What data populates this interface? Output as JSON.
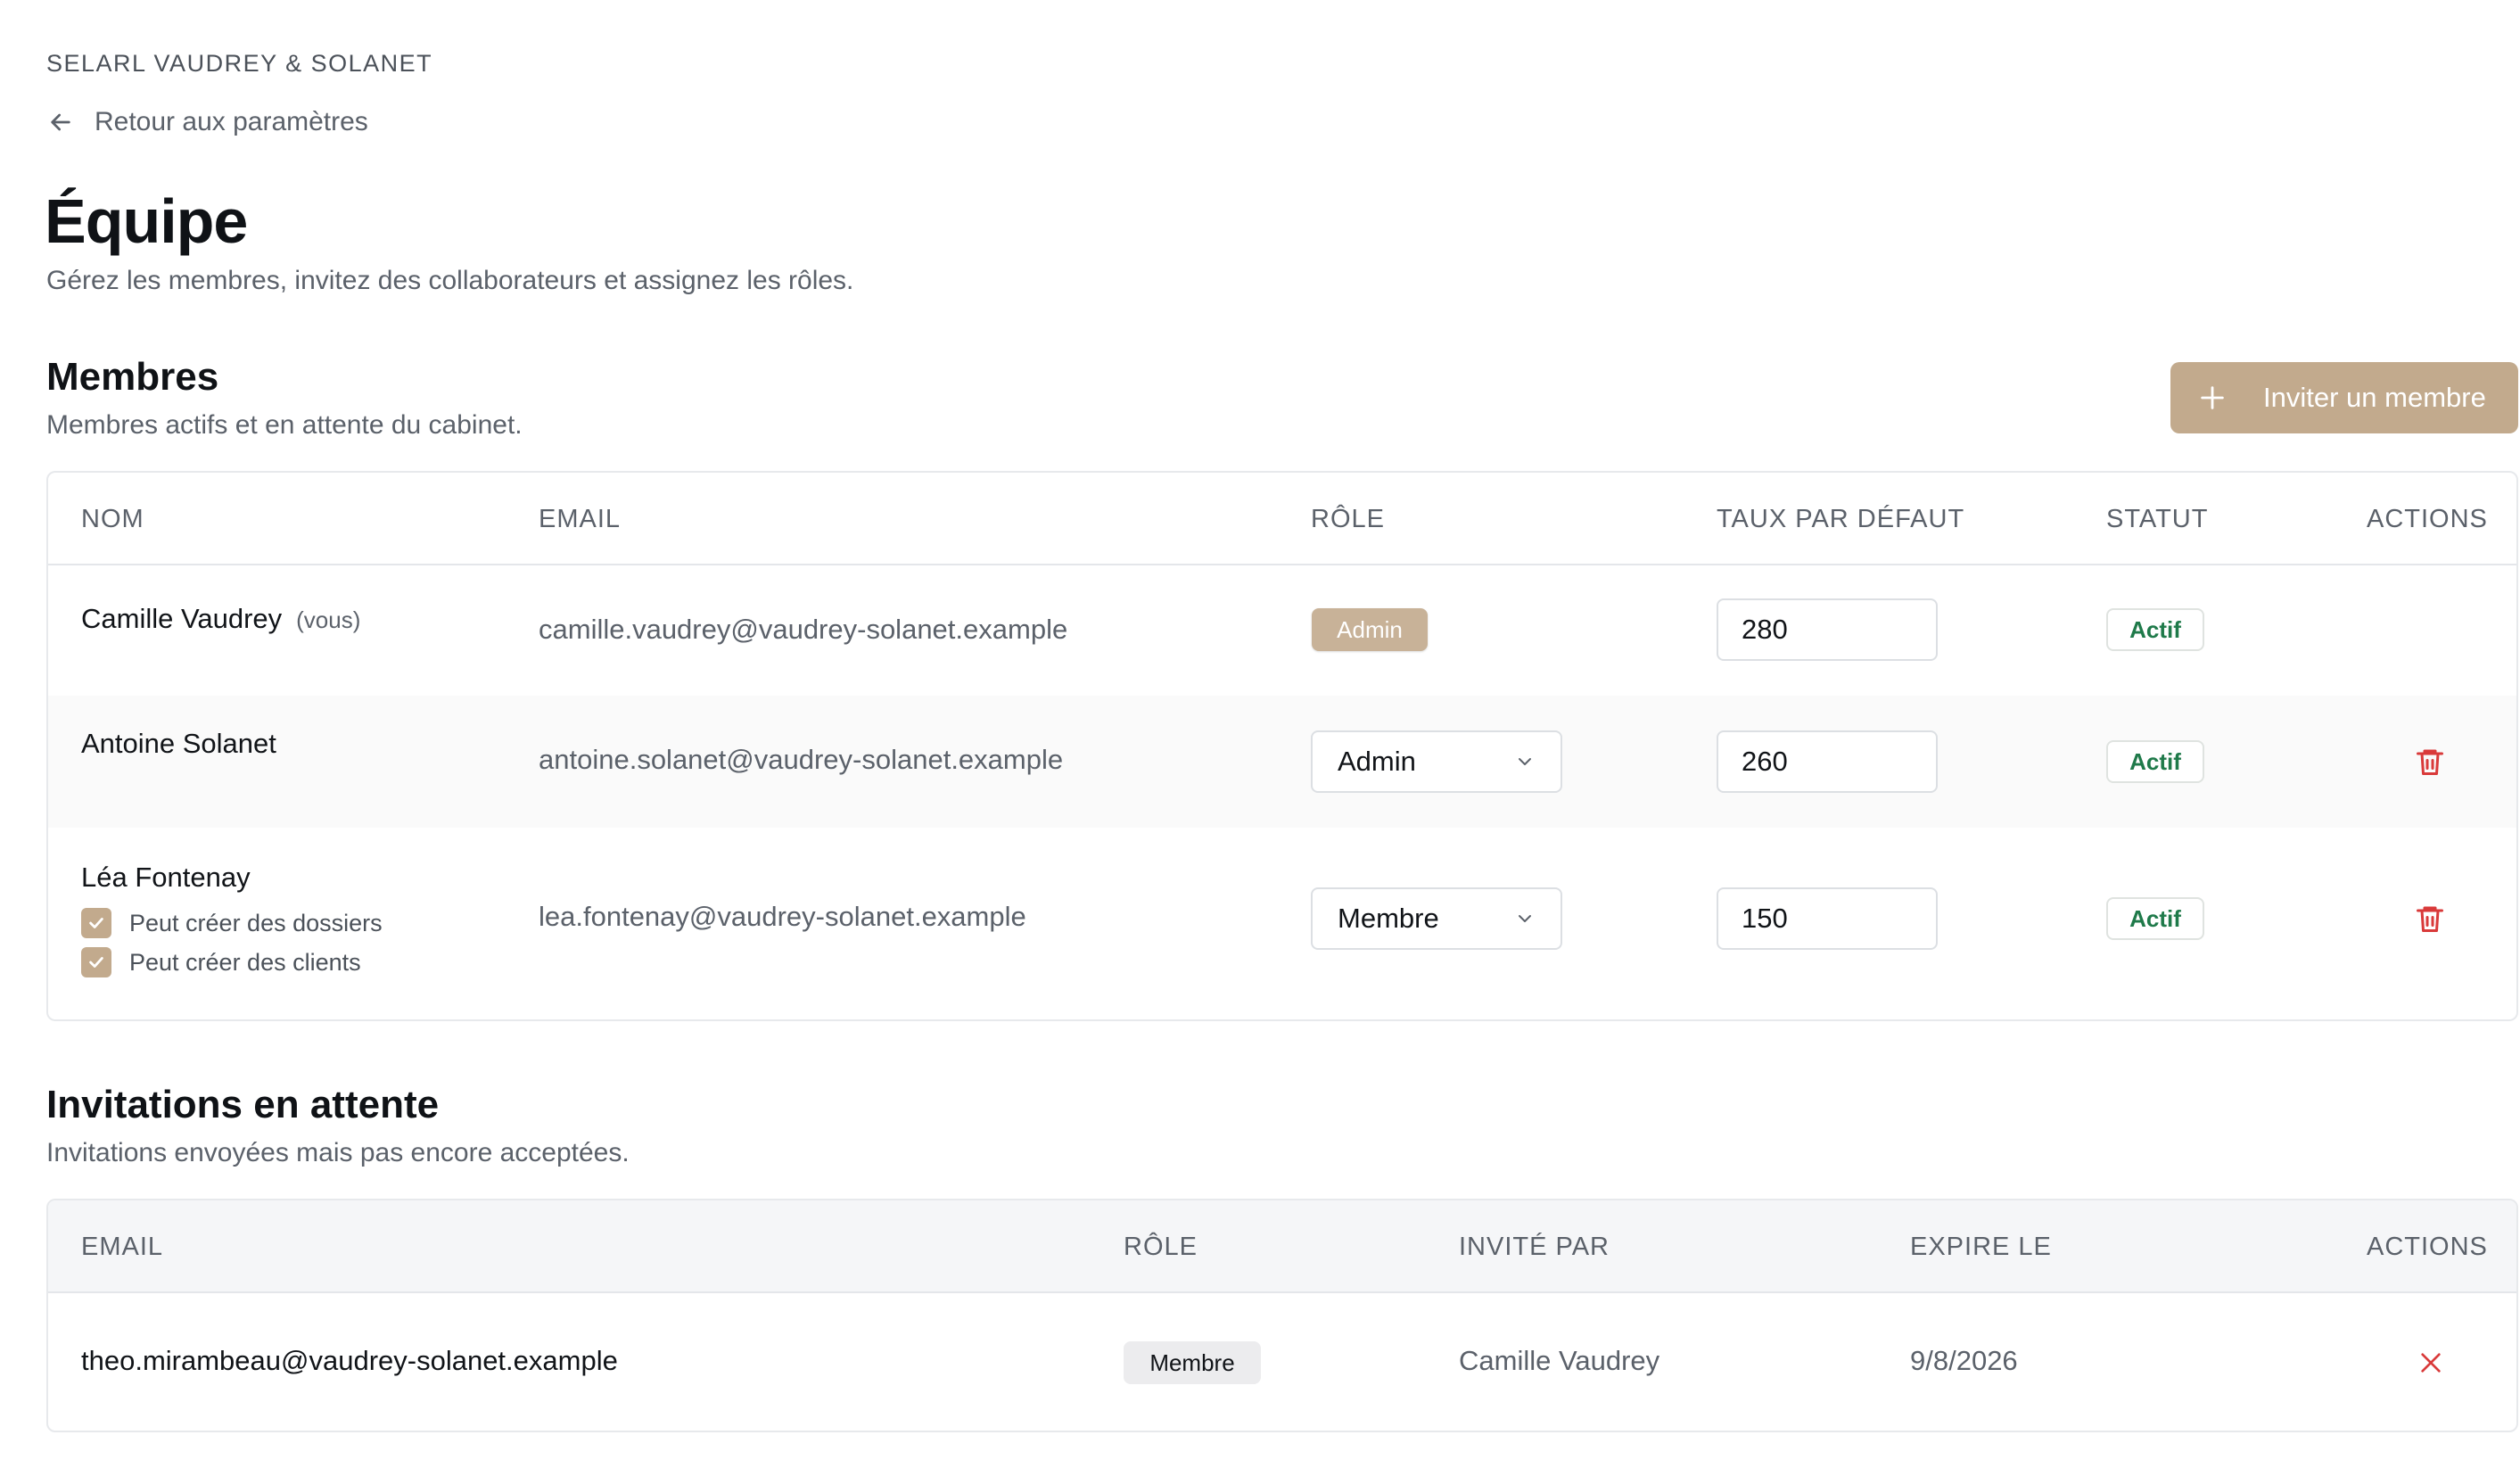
{
  "header": {
    "firm_name": "SELARL VAUDREY & SOLANET",
    "back_label": "Retour aux paramètres",
    "title": "Équipe",
    "subtitle": "Gérez les membres, invitez des collaborateurs et assignez les rôles."
  },
  "members": {
    "title": "Membres",
    "subtitle": "Membres actifs et en attente du cabinet.",
    "invite_button": "Inviter un membre",
    "columns": [
      "NOM",
      "EMAIL",
      "RÔLE",
      "TAUX PAR DÉFAUT",
      "STATUT",
      "ACTIONS"
    ],
    "rows": [
      {
        "name": "Camille Vaudrey",
        "you_tag": "(vous)",
        "email": "camille.vaudrey@vaudrey-solanet.example",
        "role": "Admin",
        "rate": "280",
        "status": "Actif"
      },
      {
        "name": "Antoine Solanet",
        "email": "antoine.solanet@vaudrey-solanet.example",
        "role": "Admin",
        "rate": "260",
        "status": "Actif"
      },
      {
        "name": "Léa Fontenay",
        "email": "lea.fontenay@vaudrey-solanet.example",
        "role": "Membre",
        "rate": "150",
        "status": "Actif",
        "permissions": [
          "Peut créer des dossiers",
          "Peut créer des clients"
        ]
      }
    ]
  },
  "invitations": {
    "title": "Invitations en attente",
    "subtitle": "Invitations envoyées mais pas encore acceptées.",
    "columns": [
      "EMAIL",
      "RÔLE",
      "INVITÉ PAR",
      "EXPIRE LE",
      "ACTIONS"
    ],
    "rows": [
      {
        "email": "theo.mirambeau@vaudrey-solanet.example",
        "role": "Membre",
        "invited_by": "Camille Vaudrey",
        "expires": "9/8/2026"
      }
    ]
  },
  "colors": {
    "accent": "#c2aa8d",
    "status_green": "#1f7a4a",
    "danger": "#d93a3a"
  },
  "icons": {
    "back": "arrow-left-icon",
    "invite": "plus-icon",
    "select": "chevron-down-icon",
    "delete": "trash-icon",
    "check": "check-icon",
    "cancel": "x-icon"
  }
}
